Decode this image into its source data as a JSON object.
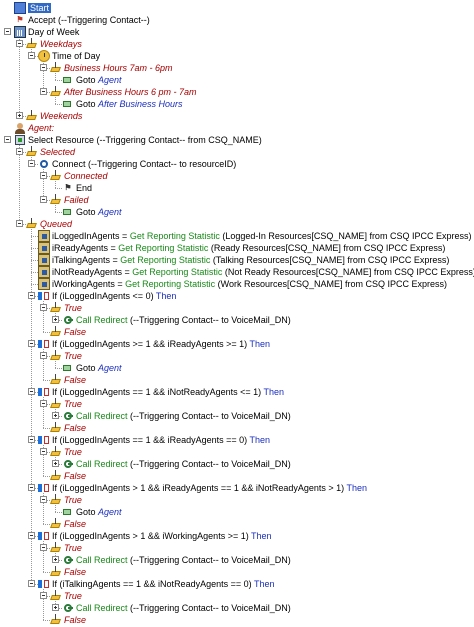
{
  "tree": {
    "nodes": [
      {
        "lvl": 0,
        "exp": "none",
        "icon": "start-icon",
        "style": "start",
        "parts": [
          {
            "t": "Start",
            "c": "k-start"
          }
        ]
      },
      {
        "lvl": 0,
        "exp": "none",
        "icon": "accept-icon",
        "style": "step",
        "parts": [
          {
            "t": "Accept (--Triggering Contact--)",
            "c": "k-step"
          }
        ]
      },
      {
        "lvl": 0,
        "exp": "minus",
        "icon": "calendar-icon",
        "style": "step",
        "parts": [
          {
            "t": "Day of Week",
            "c": "k-step"
          }
        ]
      },
      {
        "lvl": 1,
        "exp": "minus",
        "icon": "branch-icon",
        "style": "branch",
        "parts": [
          {
            "t": "Weekdays",
            "c": "k-branch"
          }
        ]
      },
      {
        "lvl": 2,
        "exp": "minus",
        "icon": "clock-icon",
        "style": "step",
        "parts": [
          {
            "t": "Time of Day",
            "c": "k-step"
          }
        ]
      },
      {
        "lvl": 3,
        "exp": "minus",
        "icon": "branch-icon",
        "style": "branch",
        "parts": [
          {
            "t": "Business Hours 7am - 6pm",
            "c": "k-branch"
          }
        ]
      },
      {
        "lvl": 4,
        "exp": "none",
        "icon": "goto-icon",
        "style": "step",
        "parts": [
          {
            "t": "Goto ",
            "c": "k-step"
          },
          {
            "t": "Agent",
            "c": "k-goto-target"
          }
        ]
      },
      {
        "lvl": 3,
        "exp": "minus",
        "icon": "branch-icon",
        "style": "branch",
        "parts": [
          {
            "t": "After Business Hours 6 pm - 7am",
            "c": "k-branch"
          }
        ]
      },
      {
        "lvl": 4,
        "exp": "none",
        "icon": "goto-icon",
        "style": "step",
        "parts": [
          {
            "t": "Goto ",
            "c": "k-step"
          },
          {
            "t": "After Business Hours",
            "c": "k-goto-target"
          }
        ]
      },
      {
        "lvl": 1,
        "exp": "plus",
        "icon": "branch-icon",
        "style": "branch",
        "parts": [
          {
            "t": "Weekends",
            "c": "k-branch"
          }
        ]
      },
      {
        "lvl": 0,
        "exp": "none",
        "icon": "agent-icon",
        "style": "branch",
        "parts": [
          {
            "t": "Agent:",
            "c": "k-branch"
          }
        ]
      },
      {
        "lvl": 0,
        "exp": "minus",
        "icon": "select-resource-icon",
        "style": "step",
        "parts": [
          {
            "t": "Select Resource (--Triggering Contact-- from CSQ_NAME)",
            "c": "k-step"
          }
        ]
      },
      {
        "lvl": 1,
        "exp": "minus",
        "icon": "branch-icon",
        "style": "branch",
        "parts": [
          {
            "t": "Selected",
            "c": "k-branch"
          }
        ]
      },
      {
        "lvl": 2,
        "exp": "minus",
        "icon": "connect-icon",
        "style": "step",
        "parts": [
          {
            "t": "Connect (--Triggering Contact-- to resourceID)",
            "c": "k-step"
          }
        ]
      },
      {
        "lvl": 3,
        "exp": "minus",
        "icon": "branch-icon",
        "style": "branch",
        "parts": [
          {
            "t": "Connected",
            "c": "k-branch"
          }
        ]
      },
      {
        "lvl": 4,
        "exp": "none",
        "icon": "end-icon",
        "style": "step",
        "parts": [
          {
            "t": "End",
            "c": "k-step"
          }
        ]
      },
      {
        "lvl": 3,
        "exp": "minus",
        "icon": "branch-icon",
        "style": "branch",
        "parts": [
          {
            "t": "Failed",
            "c": "k-branch"
          }
        ]
      },
      {
        "lvl": 4,
        "exp": "none",
        "icon": "goto-icon",
        "style": "step",
        "parts": [
          {
            "t": "Goto ",
            "c": "k-step"
          },
          {
            "t": "Agent",
            "c": "k-goto-target"
          }
        ]
      },
      {
        "lvl": 1,
        "exp": "minus",
        "icon": "branch-icon",
        "style": "branch",
        "parts": [
          {
            "t": "Queued",
            "c": "k-branch"
          }
        ]
      },
      {
        "lvl": 2,
        "exp": "none",
        "icon": "reporting-stat-icon",
        "style": "step",
        "parts": [
          {
            "t": "iLoggedInAgents = ",
            "c": "k-step"
          },
          {
            "t": "Get Reporting Statistic",
            "c": "k-green"
          },
          {
            "t": " (Logged-In Resources[CSQ_NAME] from CSQ IPCC Express)",
            "c": "k-step"
          }
        ]
      },
      {
        "lvl": 2,
        "exp": "none",
        "icon": "reporting-stat-icon",
        "style": "step",
        "parts": [
          {
            "t": "iReadyAgents = ",
            "c": "k-step"
          },
          {
            "t": "Get Reporting Statistic",
            "c": "k-green"
          },
          {
            "t": " (Ready Resources[CSQ_NAME] from CSQ IPCC Express)",
            "c": "k-step"
          }
        ]
      },
      {
        "lvl": 2,
        "exp": "none",
        "icon": "reporting-stat-icon",
        "style": "step",
        "parts": [
          {
            "t": "iTalkingAgents = ",
            "c": "k-step"
          },
          {
            "t": "Get Reporting Statistic",
            "c": "k-green"
          },
          {
            "t": " (Talking Resources[CSQ_NAME] from CSQ IPCC Express)",
            "c": "k-step"
          }
        ]
      },
      {
        "lvl": 2,
        "exp": "none",
        "icon": "reporting-stat-icon",
        "style": "step",
        "parts": [
          {
            "t": "iNotReadyAgents = ",
            "c": "k-step"
          },
          {
            "t": "Get Reporting Statistic",
            "c": "k-green"
          },
          {
            "t": " (Not Ready Resources[CSQ_NAME] from CSQ IPCC Express)",
            "c": "k-step"
          }
        ]
      },
      {
        "lvl": 2,
        "exp": "none",
        "icon": "reporting-stat-icon",
        "style": "step",
        "parts": [
          {
            "t": "iWorkingAgents = ",
            "c": "k-step"
          },
          {
            "t": "Get Reporting Statistic",
            "c": "k-green"
          },
          {
            "t": " (Work Resources[CSQ_NAME] from CSQ IPCC Express)",
            "c": "k-step"
          }
        ]
      },
      {
        "lvl": 2,
        "exp": "minus",
        "icon": "if-icon",
        "style": "step",
        "parts": [
          {
            "t": "If (iLoggedInAgents <= 0) ",
            "c": "k-step"
          },
          {
            "t": "Then",
            "c": "k-blue"
          }
        ]
      },
      {
        "lvl": 3,
        "exp": "minus",
        "icon": "branch-icon",
        "style": "branch",
        "parts": [
          {
            "t": "True",
            "c": "k-branch"
          }
        ]
      },
      {
        "lvl": 4,
        "exp": "plus",
        "icon": "call-redirect-icon",
        "style": "step",
        "parts": [
          {
            "t": "Call Redirect",
            "c": "k-green"
          },
          {
            "t": " (--Triggering Contact-- to VoiceMail_DN)",
            "c": "k-step"
          }
        ]
      },
      {
        "lvl": 3,
        "exp": "none",
        "icon": "branch-icon",
        "style": "branch",
        "parts": [
          {
            "t": "False",
            "c": "k-branch"
          }
        ]
      },
      {
        "lvl": 2,
        "exp": "minus",
        "icon": "if-icon",
        "style": "step",
        "parts": [
          {
            "t": "If (iLoggedInAgents >= 1 && iReadyAgents >= 1) ",
            "c": "k-step"
          },
          {
            "t": "Then",
            "c": "k-blue"
          }
        ]
      },
      {
        "lvl": 3,
        "exp": "minus",
        "icon": "branch-icon",
        "style": "branch",
        "parts": [
          {
            "t": "True",
            "c": "k-branch"
          }
        ]
      },
      {
        "lvl": 4,
        "exp": "none",
        "icon": "goto-icon",
        "style": "step",
        "parts": [
          {
            "t": "Goto ",
            "c": "k-step"
          },
          {
            "t": "Agent",
            "c": "k-goto-target"
          }
        ]
      },
      {
        "lvl": 3,
        "exp": "none",
        "icon": "branch-icon",
        "style": "branch",
        "parts": [
          {
            "t": "False",
            "c": "k-branch"
          }
        ]
      },
      {
        "lvl": 2,
        "exp": "minus",
        "icon": "if-icon",
        "style": "step",
        "parts": [
          {
            "t": "If (iLoggedInAgents == 1 && iNotReadyAgents <= 1) ",
            "c": "k-step"
          },
          {
            "t": "Then",
            "c": "k-blue"
          }
        ]
      },
      {
        "lvl": 3,
        "exp": "minus",
        "icon": "branch-icon",
        "style": "branch",
        "parts": [
          {
            "t": "True",
            "c": "k-branch"
          }
        ]
      },
      {
        "lvl": 4,
        "exp": "plus",
        "icon": "call-redirect-icon",
        "style": "step",
        "parts": [
          {
            "t": "Call Redirect",
            "c": "k-green"
          },
          {
            "t": " (--Triggering Contact-- to VoiceMail_DN)",
            "c": "k-step"
          }
        ]
      },
      {
        "lvl": 3,
        "exp": "none",
        "icon": "branch-icon",
        "style": "branch",
        "parts": [
          {
            "t": "False",
            "c": "k-branch"
          }
        ]
      },
      {
        "lvl": 2,
        "exp": "minus",
        "icon": "if-icon",
        "style": "step",
        "parts": [
          {
            "t": "If (iLoggedInAgents == 1 && iReadyAgents == 0) ",
            "c": "k-step"
          },
          {
            "t": "Then",
            "c": "k-blue"
          }
        ]
      },
      {
        "lvl": 3,
        "exp": "minus",
        "icon": "branch-icon",
        "style": "branch",
        "parts": [
          {
            "t": "True",
            "c": "k-branch"
          }
        ]
      },
      {
        "lvl": 4,
        "exp": "plus",
        "icon": "call-redirect-icon",
        "style": "step",
        "parts": [
          {
            "t": "Call Redirect",
            "c": "k-green"
          },
          {
            "t": " (--Triggering Contact-- to VoiceMail_DN)",
            "c": "k-step"
          }
        ]
      },
      {
        "lvl": 3,
        "exp": "none",
        "icon": "branch-icon",
        "style": "branch",
        "parts": [
          {
            "t": "False",
            "c": "k-branch"
          }
        ]
      },
      {
        "lvl": 2,
        "exp": "minus",
        "icon": "if-icon",
        "style": "step",
        "parts": [
          {
            "t": "If (iLoggedInAgents > 1 && iReadyAgents == 1 && iNotReadyAgents > 1) ",
            "c": "k-step"
          },
          {
            "t": "Then",
            "c": "k-blue"
          }
        ]
      },
      {
        "lvl": 3,
        "exp": "minus",
        "icon": "branch-icon",
        "style": "branch",
        "parts": [
          {
            "t": "True",
            "c": "k-branch"
          }
        ]
      },
      {
        "lvl": 4,
        "exp": "none",
        "icon": "goto-icon",
        "style": "step",
        "parts": [
          {
            "t": "Goto ",
            "c": "k-step"
          },
          {
            "t": "Agent",
            "c": "k-goto-target"
          }
        ]
      },
      {
        "lvl": 3,
        "exp": "none",
        "icon": "branch-icon",
        "style": "branch",
        "parts": [
          {
            "t": "False",
            "c": "k-branch"
          }
        ]
      },
      {
        "lvl": 2,
        "exp": "minus",
        "icon": "if-icon",
        "style": "step",
        "parts": [
          {
            "t": "If (iLoggedInAgents > 1 && iWorkingAgents >= 1) ",
            "c": "k-step"
          },
          {
            "t": "Then",
            "c": "k-blue"
          }
        ]
      },
      {
        "lvl": 3,
        "exp": "minus",
        "icon": "branch-icon",
        "style": "branch",
        "parts": [
          {
            "t": "True",
            "c": "k-branch"
          }
        ]
      },
      {
        "lvl": 4,
        "exp": "plus",
        "icon": "call-redirect-icon",
        "style": "step",
        "parts": [
          {
            "t": "Call Redirect",
            "c": "k-green"
          },
          {
            "t": " (--Triggering Contact-- to VoiceMail_DN)",
            "c": "k-step"
          }
        ]
      },
      {
        "lvl": 3,
        "exp": "none",
        "icon": "branch-icon",
        "style": "branch",
        "parts": [
          {
            "t": "False",
            "c": "k-branch"
          }
        ]
      },
      {
        "lvl": 2,
        "exp": "minus",
        "icon": "if-icon",
        "style": "step",
        "parts": [
          {
            "t": "If (iTalkingAgents == 1 && iNotReadyAgents == 0) ",
            "c": "k-step"
          },
          {
            "t": "Then",
            "c": "k-blue"
          }
        ]
      },
      {
        "lvl": 3,
        "exp": "minus",
        "icon": "branch-icon",
        "style": "branch",
        "parts": [
          {
            "t": "True",
            "c": "k-branch"
          }
        ]
      },
      {
        "lvl": 4,
        "exp": "plus",
        "icon": "call-redirect-icon",
        "style": "step",
        "parts": [
          {
            "t": "Call Redirect",
            "c": "k-green"
          },
          {
            "t": " (--Triggering Contact-- to VoiceMail_DN)",
            "c": "k-step"
          }
        ]
      },
      {
        "lvl": 3,
        "exp": "none",
        "icon": "branch-icon",
        "style": "branch",
        "parts": [
          {
            "t": "False",
            "c": "k-branch"
          }
        ]
      }
    ]
  },
  "colors": {
    "selection": "#316ac5",
    "branch_label": "#a80000",
    "goto_target": "#1a2ebf",
    "keyword_green": "#188a18",
    "then_blue": "#1a2ebf"
  }
}
